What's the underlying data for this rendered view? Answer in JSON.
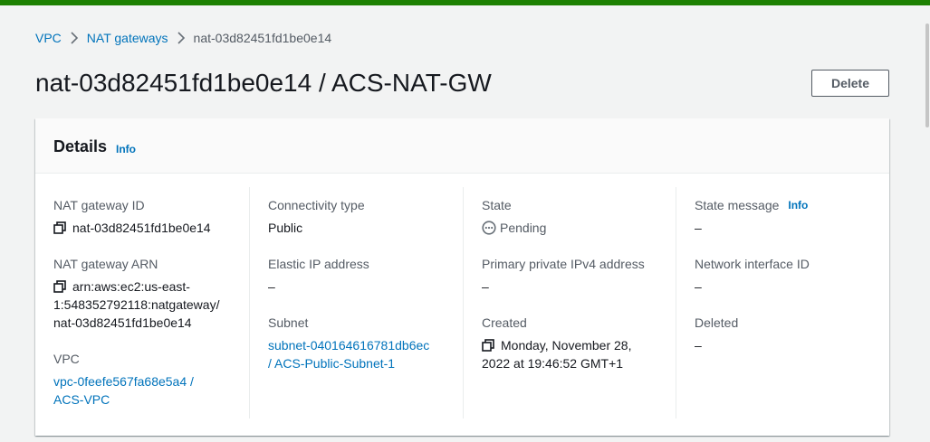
{
  "breadcrumb": {
    "items": [
      "VPC",
      "NAT gateways"
    ],
    "current": "nat-03d82451fd1be0e14"
  },
  "page": {
    "title": "nat-03d82451fd1be0e14 / ACS-NAT-GW",
    "delete_label": "Delete"
  },
  "details": {
    "title": "Details",
    "info_label": "Info",
    "nat_gateway_id": {
      "label": "NAT gateway ID",
      "value": "nat-03d82451fd1be0e14"
    },
    "nat_gateway_arn": {
      "label": "NAT gateway ARN",
      "line1": "arn:aws:ec2:us-east-",
      "line2": "1:548352792118:natgateway/",
      "line3": "nat-03d82451fd1be0e14"
    },
    "vpc": {
      "label": "VPC",
      "line1": "vpc-0feefe567fa68e5a4 /",
      "line2": "ACS-VPC"
    },
    "connectivity_type": {
      "label": "Connectivity type",
      "value": "Public"
    },
    "elastic_ip": {
      "label": "Elastic IP address",
      "value": "–"
    },
    "subnet": {
      "label": "Subnet",
      "line1": "subnet-040164616781db6ec",
      "line2": "/ ACS-Public-Subnet-1"
    },
    "state": {
      "label": "State",
      "value": "Pending",
      "icon": "pending-icon"
    },
    "private_ipv4": {
      "label": "Primary private IPv4 address",
      "value": "–"
    },
    "created": {
      "label": "Created",
      "line1": "Monday, November 28,",
      "line2": "2022 at 19:46:52 GMT+1"
    },
    "state_message": {
      "label": "State message",
      "info_label": "Info",
      "value": "–"
    },
    "network_interface": {
      "label": "Network interface ID",
      "value": "–"
    },
    "deleted": {
      "label": "Deleted",
      "value": "–"
    }
  },
  "colors": {
    "top_bar": "#1d8102",
    "link": "#0073bb",
    "text": "#16191f",
    "label": "#545b64"
  }
}
